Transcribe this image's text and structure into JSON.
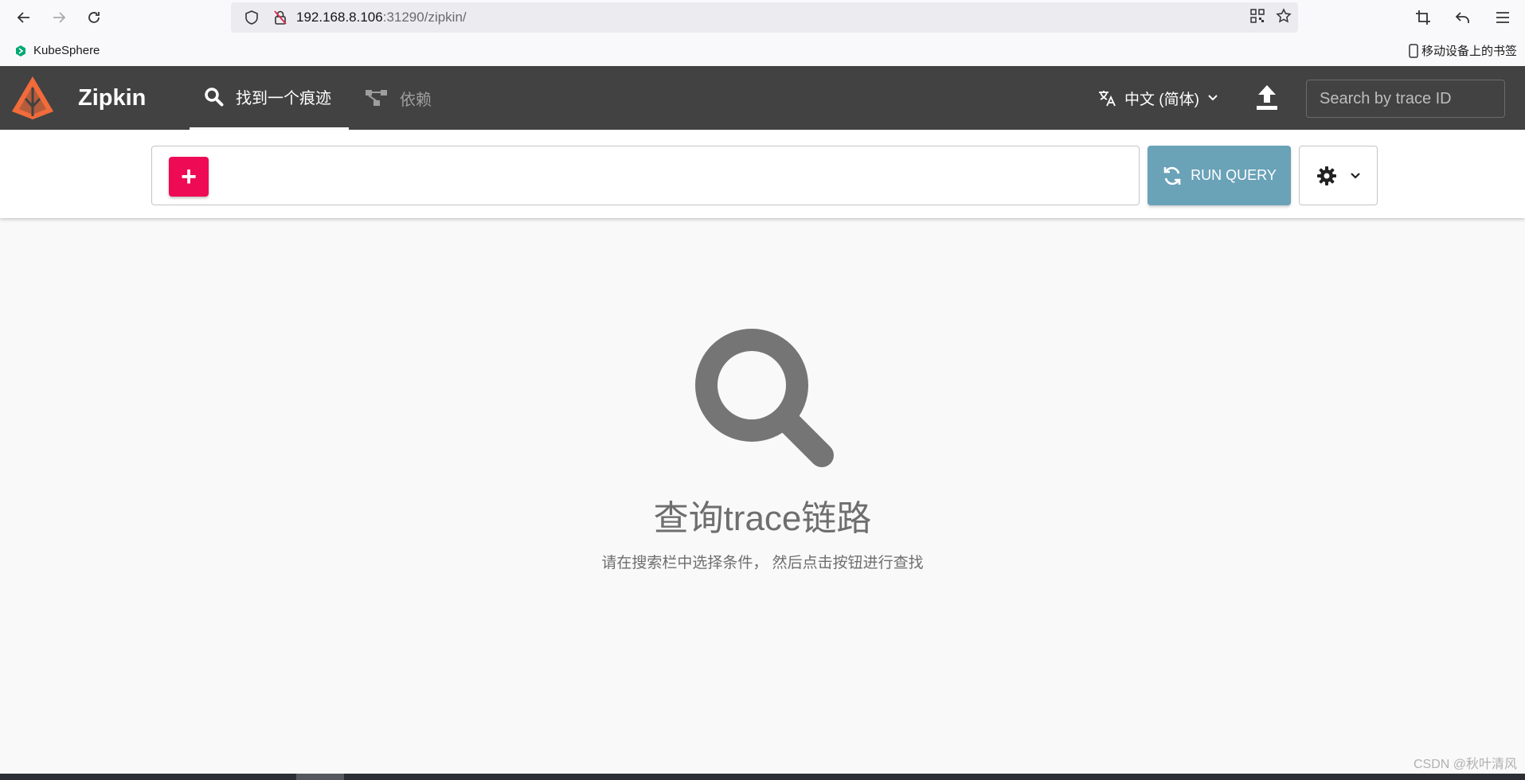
{
  "browser": {
    "url_host": "192.168.8.106",
    "url_rest": ":31290/zipkin/",
    "bookmarks": [
      {
        "label": "KubeSphere"
      }
    ],
    "mobile_bookmarks_label": "移动设备上的书签"
  },
  "header": {
    "app_title": "Zipkin",
    "tabs": [
      {
        "label": "找到一个痕迹",
        "active": true
      },
      {
        "label": "依赖",
        "active": false
      }
    ],
    "language": "中文 (简体)",
    "search_placeholder": "Search by trace ID"
  },
  "query": {
    "add_label": "+",
    "run_label": "RUN QUERY"
  },
  "empty_state": {
    "title": "查询trace链路",
    "subtitle": "请在搜索栏中选择条件，  然后点击按钮进行查找"
  },
  "watermark": "CSDN @秋叶清风",
  "colors": {
    "header_bg": "#424242",
    "add_button": "#ef0a55",
    "run_button": "#6aa2b8",
    "logo": "#f26b3a"
  }
}
